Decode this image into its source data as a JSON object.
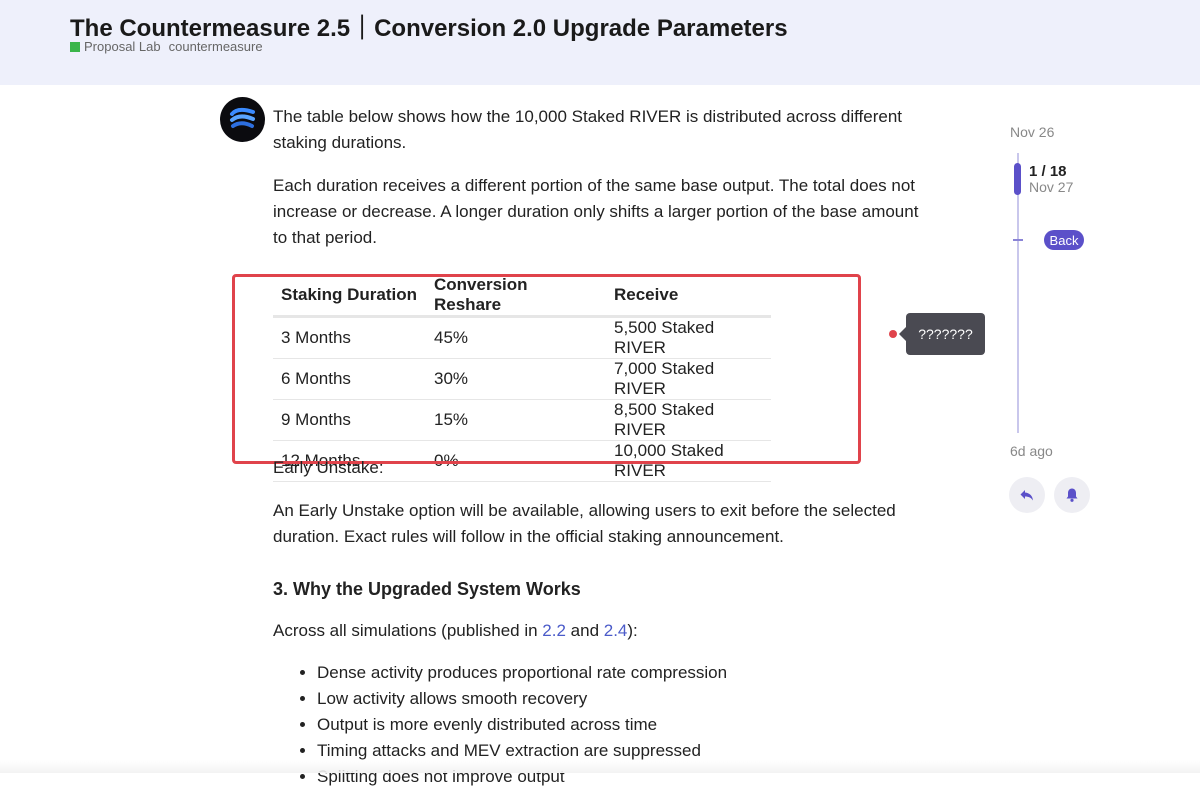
{
  "topic": {
    "title": "The Countermeasure 2.5｜Conversion 2.0 Upgrade Parameters",
    "category": "Proposal Lab",
    "tag": "countermeasure",
    "category_color": "#3ab54a"
  },
  "post": {
    "avatar_icon": "river-logo-icon",
    "p1": "The table below shows how the 10,000 Staked RIVER is distributed across different staking durations.",
    "p2": "Each duration receives a different portion of the same base output. The total does not increase or decrease. A longer duration only shifts a larger portion of the base amount to that period.",
    "table": {
      "headers": [
        "Staking Duration",
        "Conversion Reshare",
        "Receive"
      ],
      "rows": [
        [
          "3 Months",
          "45%",
          "5,500 Staked RIVER"
        ],
        [
          "6 Months",
          "30%",
          "7,000 Staked RIVER"
        ],
        [
          "9 Months",
          "15%",
          "8,500 Staked RIVER"
        ],
        [
          "12 Months",
          "0%",
          "10,000 Staked RIVER"
        ]
      ]
    },
    "tooltip": "???????",
    "p3": "Early Unstake:",
    "p4": "An Early Unstake option will be available, allowing users to exit before the selected duration. Exact rules will follow in the official staking announcement.",
    "h3": "3. Why the Upgraded System Works",
    "p5_prefix": "Across all simulations (published in ",
    "p5_link1": "2.2",
    "p5_mid": " and ",
    "p5_link2": "2.4",
    "p5_suffix": "):",
    "bullets": [
      "Dense activity produces proportional rate compression",
      "Low activity allows smooth recovery",
      "Output is more evenly distributed across time",
      "Timing attacks and MEV extraction are suppressed",
      "Splitting does not improve output"
    ]
  },
  "timeline": {
    "top_date": "Nov 26",
    "position": "1 / 18",
    "current_date": "Nov 27",
    "back_label": "Back",
    "bottom_label": "6d ago",
    "accent": "#5b50c9"
  },
  "colors": {
    "highlight_box": "#e0434b",
    "header_bg": "#eef0fb",
    "link": "#4b5bc9"
  }
}
